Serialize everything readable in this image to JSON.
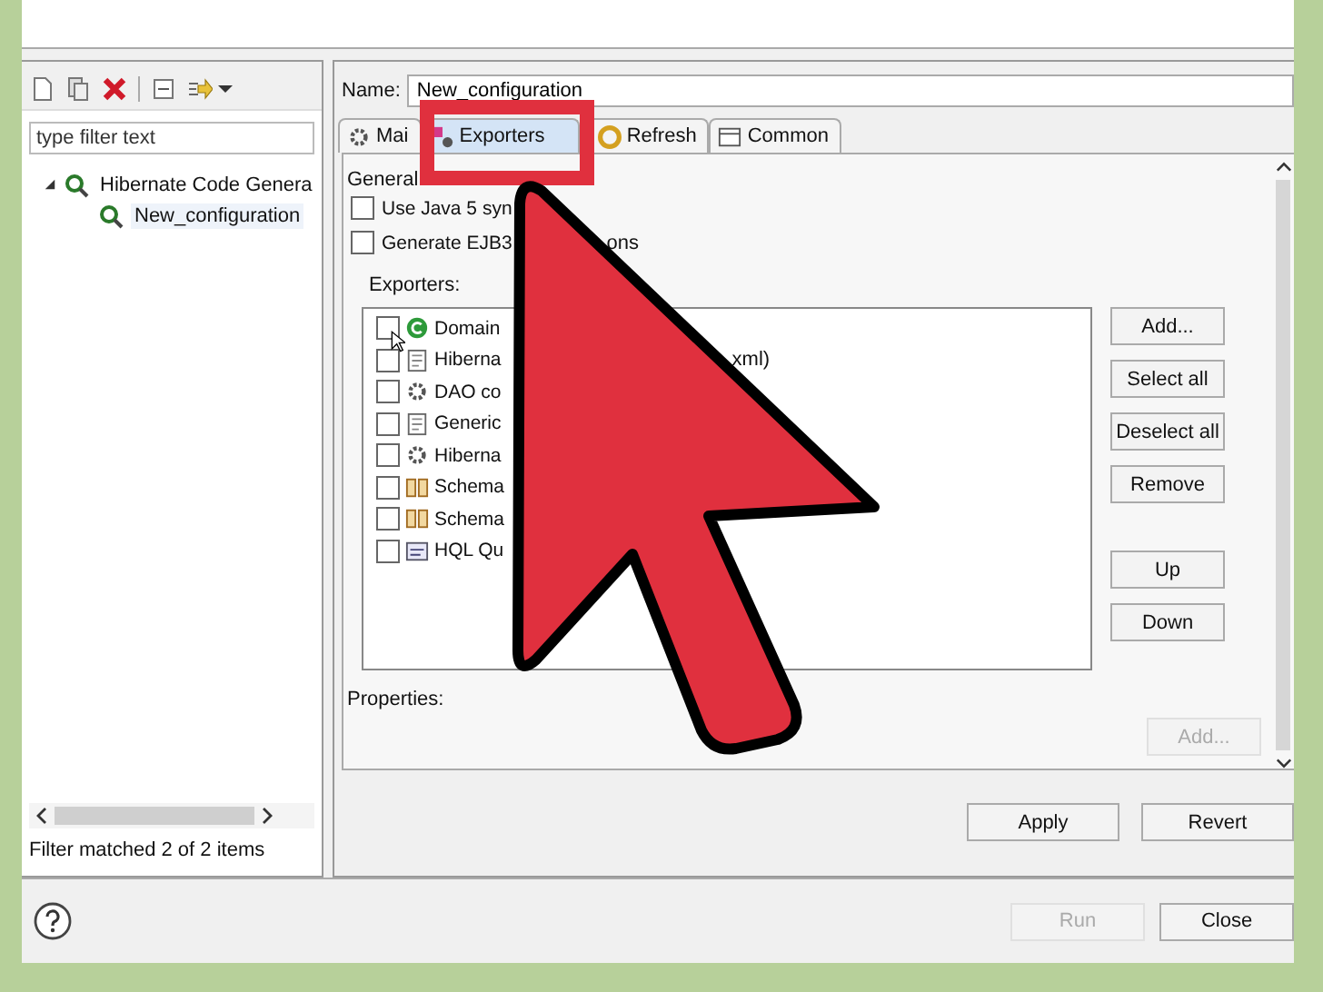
{
  "left_panel": {
    "filter": {
      "placeholder": "type filter text"
    },
    "tree": [
      {
        "label": "Hibernate Code Genera",
        "expanded": true,
        "selected": false,
        "children": [
          {
            "label": "New_configuration",
            "selected": true
          }
        ]
      }
    ],
    "status": "Filter matched 2 of 2 items"
  },
  "name": {
    "label": "Name:",
    "value": "New_configuration"
  },
  "tabs": [
    {
      "label": "Mai",
      "selected": false,
      "kind": "gear"
    },
    {
      "label": "Exporters",
      "selected": true,
      "kind": "export"
    },
    {
      "label": "Refresh",
      "selected": false,
      "kind": "refresh"
    },
    {
      "label": "Common",
      "selected": false,
      "kind": "window"
    }
  ],
  "general_heading": "General",
  "options": [
    {
      "label": "Use Java 5 syn",
      "checked": false
    },
    {
      "label": "Generate EJB3",
      "tail": "ons",
      "checked": false
    }
  ],
  "exporters_label": "Exporters:",
  "exporters": [
    {
      "label": "Domain",
      "checked": false,
      "kind": "class"
    },
    {
      "label": "Hiberna",
      "tail": "xml)",
      "checked": false,
      "kind": "doc"
    },
    {
      "label": "DAO co",
      "checked": false,
      "kind": "gear"
    },
    {
      "label": "Generic",
      "checked": false,
      "kind": "doc"
    },
    {
      "label": "Hiberna",
      "checked": false,
      "kind": "gear"
    },
    {
      "label": "Schema",
      "checked": false,
      "kind": "schema"
    },
    {
      "label": "Schema",
      "checked": false,
      "kind": "schema"
    },
    {
      "label": "HQL Qu",
      "checked": false,
      "kind": "hql"
    }
  ],
  "exporter_buttons": [
    {
      "label": "Add...",
      "disabled": false
    },
    {
      "label": "Select all",
      "disabled": false
    },
    {
      "label": "Deselect all",
      "disabled": false
    },
    {
      "label": "Remove",
      "disabled": false
    },
    {
      "label": "Up",
      "disabled": false
    },
    {
      "label": "Down",
      "disabled": false
    }
  ],
  "properties_label": "Properties:",
  "properties_add": {
    "label": "Add...",
    "disabled": true
  },
  "config_buttons": [
    {
      "label": "Apply",
      "disabled": false
    },
    {
      "label": "Revert",
      "disabled": false
    }
  ],
  "dialog_buttons": [
    {
      "label": "Run",
      "disabled": true
    },
    {
      "label": "Close",
      "disabled": false
    }
  ]
}
